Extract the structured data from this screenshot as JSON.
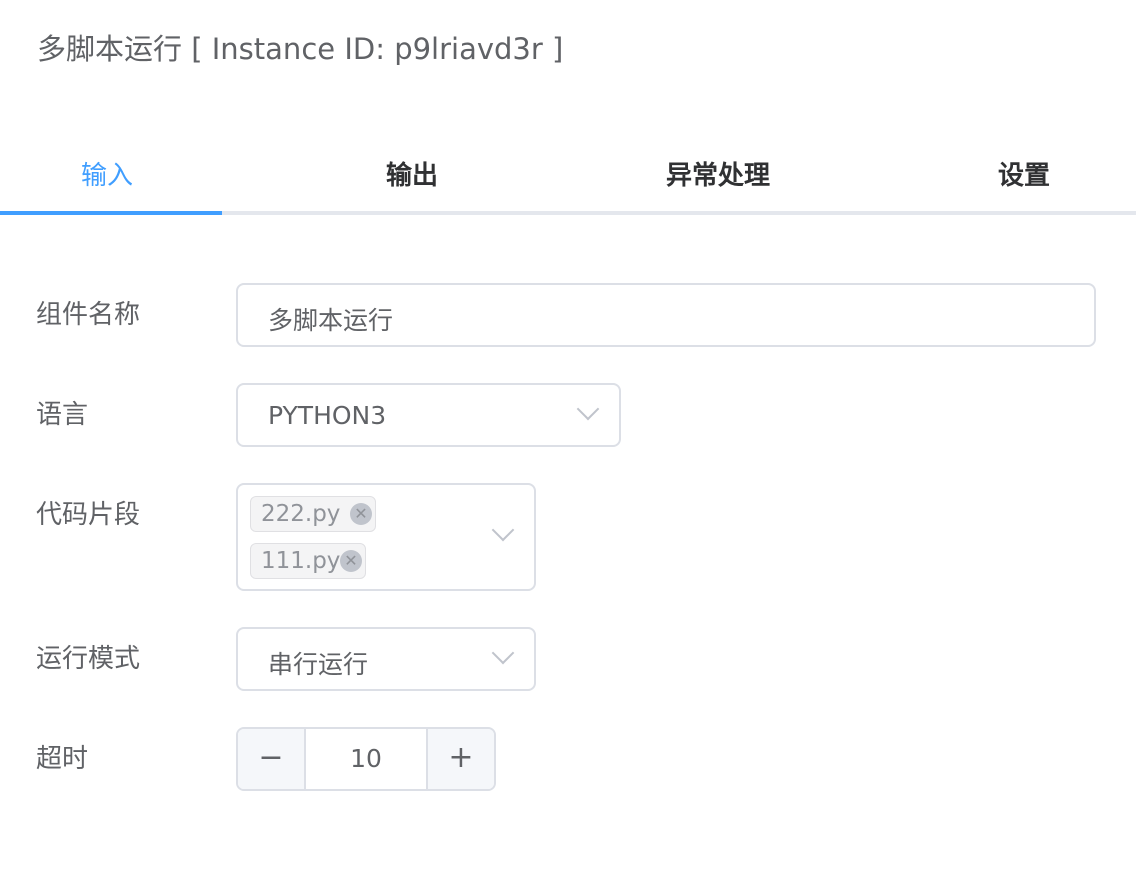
{
  "header": {
    "title": "多脚本运行 [ Instance ID: p9lriavd3r ]"
  },
  "tabs": [
    {
      "label": "输入",
      "active": true
    },
    {
      "label": "输出",
      "active": false
    },
    {
      "label": "异常处理",
      "active": false
    },
    {
      "label": "设置",
      "active": false
    }
  ],
  "form": {
    "component_name": {
      "label": "组件名称",
      "value": "多脚本运行"
    },
    "language": {
      "label": "语言",
      "value": "PYTHON3"
    },
    "code_snippets": {
      "label": "代码片段",
      "tags": [
        "222.py",
        "111.py"
      ]
    },
    "run_mode": {
      "label": "运行模式",
      "value": "串行运行"
    },
    "timeout": {
      "label": "超时",
      "value": "10",
      "minus_symbol": "−",
      "plus_symbol": "+"
    }
  },
  "icons": {
    "dropdown": "chevron-down-icon",
    "tag_close": "close-circle-icon"
  },
  "colors": {
    "accent": "#409eff",
    "border": "#dcdfe6",
    "text_primary": "#303133",
    "text_regular": "#606266",
    "tag_bg": "#f4f4f5"
  }
}
